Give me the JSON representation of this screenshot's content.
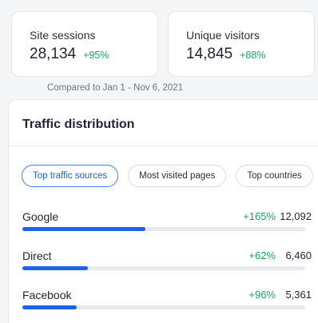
{
  "metrics": {
    "sessions": {
      "label": "Site sessions",
      "value": "28,134",
      "change": "+95%"
    },
    "visitors": {
      "label": "Unique visitors",
      "value": "14,845",
      "change": "+88%"
    }
  },
  "compare_note": "Compared to Jan 1 - Nov 6, 2021",
  "traffic": {
    "title": "Traffic distribution",
    "tabs": [
      {
        "label": "Top traffic sources",
        "active": true
      },
      {
        "label": "Most visited pages",
        "active": false
      },
      {
        "label": "Top countries",
        "active": false
      }
    ],
    "rows": [
      {
        "label": "Google",
        "change": "+165%",
        "value": "12,092",
        "share": 0.436
      },
      {
        "label": "Direct",
        "change": "+62%",
        "value": "6,460",
        "share": 0.233
      },
      {
        "label": "Facebook",
        "change": "+96%",
        "value": "5,361",
        "share": 0.193
      }
    ]
  },
  "colors": {
    "positive": "#19a463",
    "accent": "#1d63e8",
    "active_tab": "#3a7bf6"
  }
}
